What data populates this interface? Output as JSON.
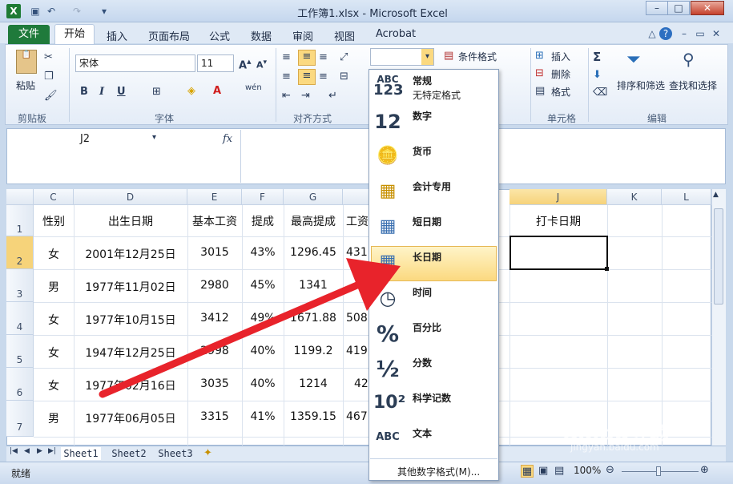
{
  "window": {
    "title": "工作簿1.xlsx - Microsoft Excel",
    "app_icon": "X"
  },
  "tabs": {
    "file": "文件",
    "home": "开始",
    "items": [
      "插入",
      "页面布局",
      "公式",
      "数据",
      "审阅",
      "视图",
      "Acrobat"
    ]
  },
  "ribbon": {
    "clipboard": {
      "paste": "粘贴",
      "label": "剪贴板"
    },
    "font": {
      "name": "宋体",
      "size": "11",
      "label": "字体",
      "bold": "B",
      "italic": "I",
      "underline": "U"
    },
    "alignment": {
      "label": "对齐方式"
    },
    "styles": {
      "conditional": "条件格式"
    },
    "cells": {
      "insert": "插入",
      "delete": "删除",
      "format": "格式",
      "label": "单元格"
    },
    "editing": {
      "sort": "排序和筛选",
      "find": "查找和选择",
      "label": "编辑"
    }
  },
  "formula_bar": {
    "name_box": "J2",
    "fx": "fx"
  },
  "sheet": {
    "columns": [
      "C",
      "D",
      "E",
      "F",
      "G",
      "",
      "J",
      "K",
      "L"
    ],
    "rows": [
      "1",
      "2",
      "3",
      "4",
      "5",
      "6",
      "7"
    ],
    "header": [
      "性别",
      "出生日期",
      "基本工资",
      "提成",
      "最高提成",
      "工资",
      "打卡日期"
    ],
    "data": [
      [
        "女",
        "2001年12月25日",
        "3015",
        "43%",
        "1296.45",
        "431"
      ],
      [
        "男",
        "1977年11月02日",
        "2980",
        "45%",
        "1341",
        ""
      ],
      [
        "女",
        "1977年10月15日",
        "3412",
        "49%",
        "1671.88",
        "508"
      ],
      [
        "女",
        "1947年12月25日",
        "2998",
        "40%",
        "1199.2",
        "419"
      ],
      [
        "女",
        "1977年02月16日",
        "3035",
        "40%",
        "1214",
        "42"
      ],
      [
        "男",
        "1977年06月05日",
        "3315",
        "41%",
        "1359.15",
        "467"
      ]
    ]
  },
  "sheet_tabs": [
    "Sheet1",
    "Sheet2",
    "Sheet3"
  ],
  "status": {
    "ready": "就绪",
    "zoom": "100%"
  },
  "number_format_menu": {
    "items": [
      {
        "icon": "ABC 123",
        "label": "常规",
        "sub": "无特定格式"
      },
      {
        "icon": "12",
        "label": "数字"
      },
      {
        "icon": "currency",
        "label": "货币"
      },
      {
        "icon": "accounting",
        "label": "会计专用"
      },
      {
        "icon": "calendar",
        "label": "短日期"
      },
      {
        "icon": "calendar",
        "label": "长日期"
      },
      {
        "icon": "clock",
        "label": "时间"
      },
      {
        "icon": "%",
        "label": "百分比"
      },
      {
        "icon": "½",
        "label": "分数"
      },
      {
        "icon": "10²",
        "label": "科学记数"
      },
      {
        "icon": "ABC",
        "label": "文本"
      }
    ],
    "more": "其他数字格式(M)...",
    "selected_index": 5
  },
  "watermark": {
    "text": "Baidu经验",
    "sub": "jingyan.baidu.com"
  },
  "colors": {
    "accent_green": "#1f7a3b",
    "arrow_red": "#e8232b",
    "selection": "#fbd980"
  }
}
